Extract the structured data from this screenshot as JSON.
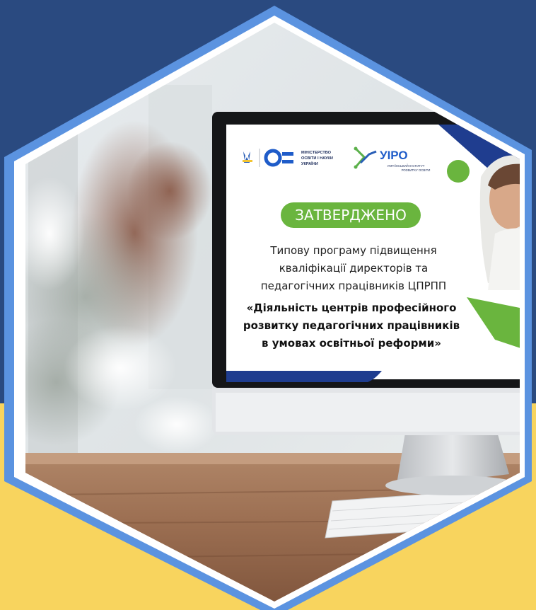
{
  "colors": {
    "background_blue": "#2a4a80",
    "background_yellow": "#f8d45e",
    "hexagon_border": "#5b93e0",
    "badge_green": "#6ab53e",
    "accent_navy": "#1f3d8f"
  },
  "screen": {
    "header": {
      "ministry_lines": [
        "МІНІСТЕРСТВО",
        "ОСВІТИ І НАУКИ",
        "УКРАЇНИ"
      ],
      "uipo_name": "УІРО",
      "uipo_sub_lines": [
        "УКРАЇНСЬКИЙ ІНСТИТУТ",
        "РОЗВИТКУ ОСВІТИ"
      ]
    },
    "badge": "ЗАТВЕРДЖЕНО",
    "body_lines": [
      "Типову програму підвищення",
      "кваліфікації директорів та",
      "педагогічних працівників ЦПРПП"
    ],
    "bold_lines": [
      "«Діяльність центрів професійного",
      "розвитку педагогічних працівників",
      "в умовах освітньої реформи»"
    ]
  },
  "icons": [
    "trident-icon",
    "ministry-logo-icon",
    "uipo-logo-icon"
  ]
}
